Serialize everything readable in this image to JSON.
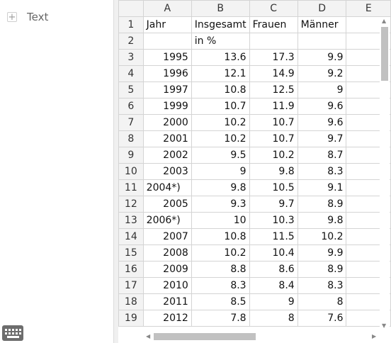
{
  "sidebar": {
    "text_tool_label": "Text",
    "add_icon": "plus-icon",
    "keyboard_icon": "keyboard-icon"
  },
  "sheet": {
    "column_headers": [
      "A",
      "B",
      "C",
      "D",
      "E"
    ],
    "rows": [
      {
        "n": "1",
        "a": "Jahr",
        "b": "Insgesamt",
        "c": "Frauen",
        "d": "Männer",
        "e": ""
      },
      {
        "n": "2",
        "a": "",
        "b": "in %",
        "c": "",
        "d": "",
        "e": ""
      },
      {
        "n": "3",
        "a": "1995",
        "b": "13.6",
        "c": "17.3",
        "d": "9.9",
        "e": ""
      },
      {
        "n": "4",
        "a": "1996",
        "b": "12.1",
        "c": "14.9",
        "d": "9.2",
        "e": ""
      },
      {
        "n": "5",
        "a": "1997",
        "b": "10.8",
        "c": "12.5",
        "d": "9",
        "e": ""
      },
      {
        "n": "6",
        "a": "1999",
        "b": "10.7",
        "c": "11.9",
        "d": "9.6",
        "e": ""
      },
      {
        "n": "7",
        "a": "2000",
        "b": "10.2",
        "c": "10.7",
        "d": "9.6",
        "e": ""
      },
      {
        "n": "8",
        "a": "2001",
        "b": "10.2",
        "c": "10.7",
        "d": "9.7",
        "e": ""
      },
      {
        "n": "9",
        "a": "2002",
        "b": "9.5",
        "c": "10.2",
        "d": "8.7",
        "e": ""
      },
      {
        "n": "10",
        "a": "2003",
        "b": "9",
        "c": "9.8",
        "d": "8.3",
        "e": ""
      },
      {
        "n": "11",
        "a": "2004*)",
        "b": "9.8",
        "c": "10.5",
        "d": "9.1",
        "e": ""
      },
      {
        "n": "12",
        "a": "2005",
        "b": "9.3",
        "c": "9.7",
        "d": "8.9",
        "e": ""
      },
      {
        "n": "13",
        "a": "2006*)",
        "b": "10",
        "c": "10.3",
        "d": "9.8",
        "e": ""
      },
      {
        "n": "14",
        "a": "2007",
        "b": "10.8",
        "c": "11.5",
        "d": "10.2",
        "e": ""
      },
      {
        "n": "15",
        "a": "2008",
        "b": "10.2",
        "c": "10.4",
        "d": "9.9",
        "e": ""
      },
      {
        "n": "16",
        "a": "2009",
        "b": "8.8",
        "c": "8.6",
        "d": "8.9",
        "e": ""
      },
      {
        "n": "17",
        "a": "2010",
        "b": "8.3",
        "c": "8.4",
        "d": "8.3",
        "e": ""
      },
      {
        "n": "18",
        "a": "2011",
        "b": "8.5",
        "c": "9",
        "d": "8",
        "e": ""
      },
      {
        "n": "19",
        "a": "2012",
        "b": "7.8",
        "c": "8",
        "d": "7.6",
        "e": ""
      }
    ]
  }
}
